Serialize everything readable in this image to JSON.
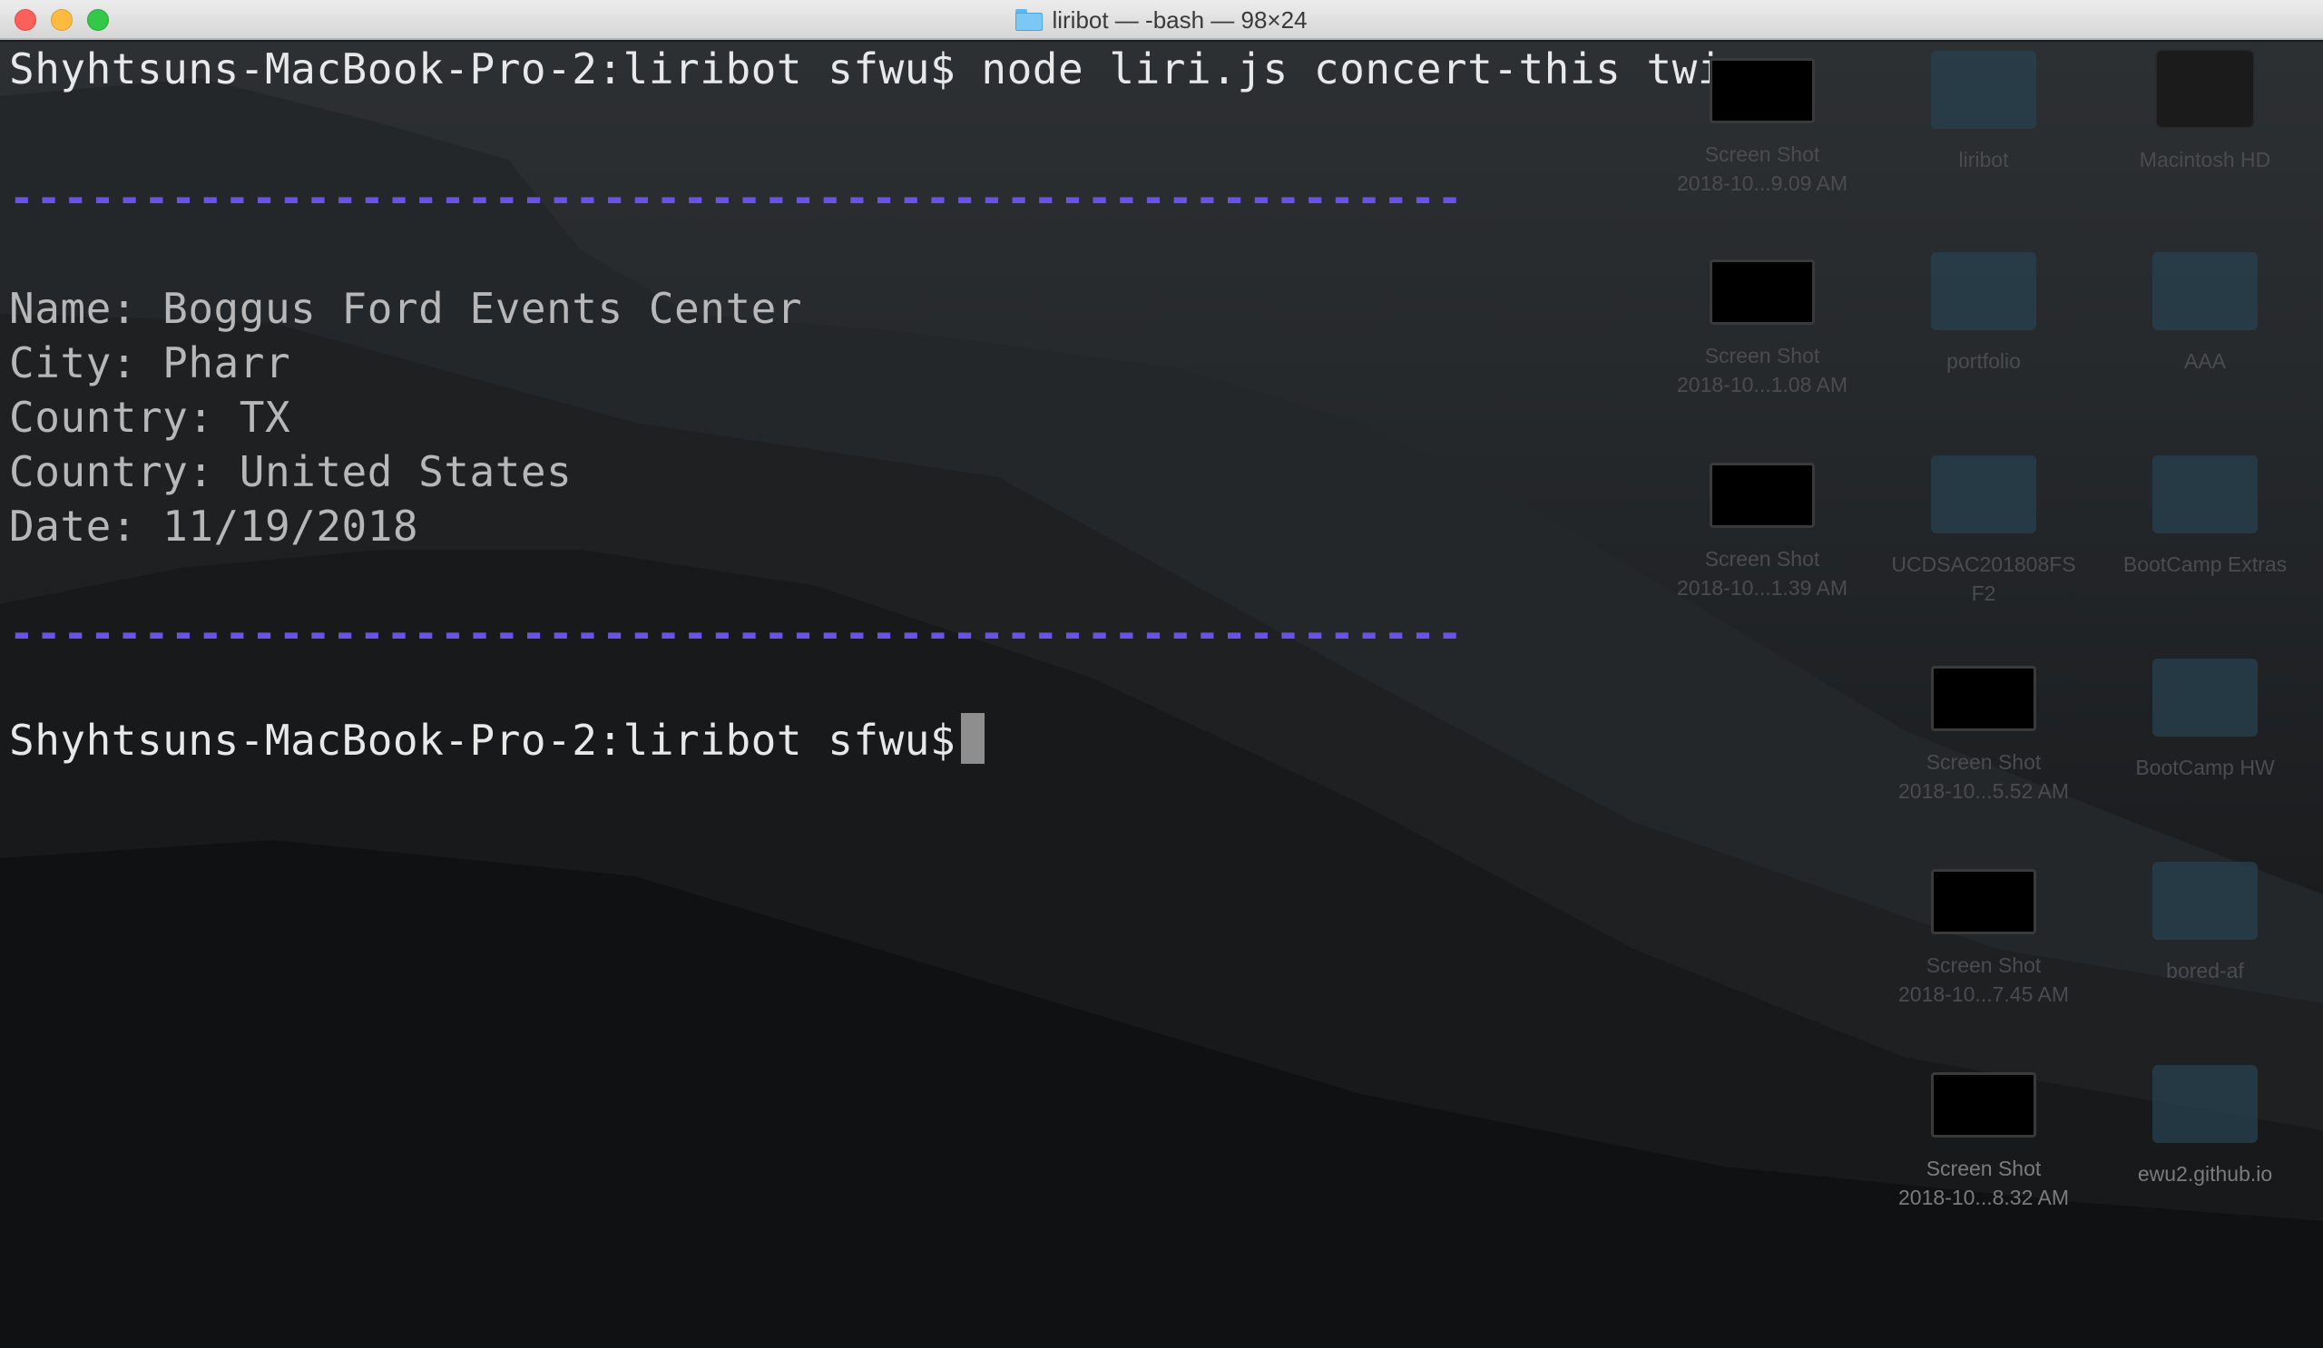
{
  "window": {
    "title": "liribot — -bash — 98×24"
  },
  "terminal": {
    "command_prompt": "Shyhtsuns-MacBook-Pro-2:liribot sfwu$",
    "command": "node liri.js concert-this twice",
    "divider": "------------------------------------------------------",
    "output": [
      "Name: Boggus Ford Events Center",
      "City: Pharr",
      "Country: TX",
      "Country: United States",
      "Date: 11/19/2018"
    ],
    "final_prompt": "Shyhtsuns-MacBook-Pro-2:liribot sfwu$"
  },
  "desktop": {
    "icons": [
      {
        "kind": "screenshot",
        "line1": "Screen Shot",
        "line2": "2018-10...9.09 AM"
      },
      {
        "kind": "folder",
        "line1": "liribot",
        "line2": ""
      },
      {
        "kind": "disk",
        "line1": "Macintosh HD",
        "line2": ""
      },
      {
        "kind": "screenshot",
        "line1": "Screen Shot",
        "line2": "2018-10...1.08 AM"
      },
      {
        "kind": "folder",
        "line1": "portfolio",
        "line2": ""
      },
      {
        "kind": "folder",
        "line1": "AAA",
        "line2": ""
      },
      {
        "kind": "screenshot",
        "line1": "Screen Shot",
        "line2": "2018-10...1.39 AM"
      },
      {
        "kind": "folder",
        "line1": "UCDSAC201808FS",
        "line2": "F2"
      },
      {
        "kind": "folder",
        "line1": "BootCamp Extras",
        "line2": ""
      },
      {
        "kind": "screenshot",
        "line1": "Screen Shot",
        "line2": "2018-10...5.52 AM"
      },
      {
        "kind": "folder",
        "line1": "BootCamp HW",
        "line2": ""
      },
      {
        "kind": "screenshot",
        "line1": "Screen Shot",
        "line2": "2018-10...7.45 AM"
      },
      {
        "kind": "folder",
        "line1": "bored-af",
        "line2": ""
      },
      {
        "kind": "screenshot",
        "line1": "Screen Shot",
        "line2": "2018-10...8.32 AM"
      },
      {
        "kind": "folder",
        "line1": "ewu2.github.io",
        "line2": ""
      }
    ]
  },
  "colors": {
    "divider": "#6a52e8",
    "prompt_text": "#e8e8e8",
    "output_text": "#b7b7b7",
    "cursor": "#8e8e8e"
  }
}
